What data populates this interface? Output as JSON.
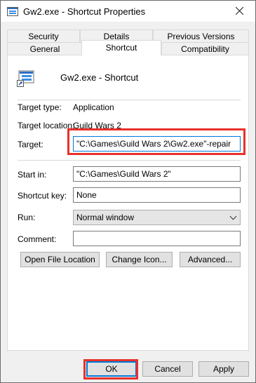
{
  "window": {
    "title": "Gw2.exe - Shortcut Properties"
  },
  "tabs": {
    "row1": [
      "Security",
      "Details",
      "Previous Versions"
    ],
    "row2": [
      "General",
      "Shortcut",
      "Compatibility"
    ],
    "active": "Shortcut"
  },
  "shortcut": {
    "name": "Gw2.exe - Shortcut",
    "target_type_label": "Target type:",
    "target_type": "Application",
    "target_location_label": "Target location:",
    "target_location": "Guild Wars 2",
    "target_label": "Target:",
    "target": "\"C:\\Games\\Guild Wars 2\\Gw2.exe\"-repair",
    "start_in_label": "Start in:",
    "start_in": "\"C:\\Games\\Guild Wars 2\"",
    "shortcut_key_label": "Shortcut key:",
    "shortcut_key": "None",
    "run_label": "Run:",
    "run": "Normal window",
    "comment_label": "Comment:",
    "comment": ""
  },
  "actions": {
    "open_file_location": "Open File Location",
    "change_icon": "Change Icon...",
    "advanced": "Advanced..."
  },
  "footer": {
    "ok": "OK",
    "cancel": "Cancel",
    "apply": "Apply"
  },
  "colors": {
    "highlight": "#e8302a",
    "accent": "#0078d7"
  }
}
